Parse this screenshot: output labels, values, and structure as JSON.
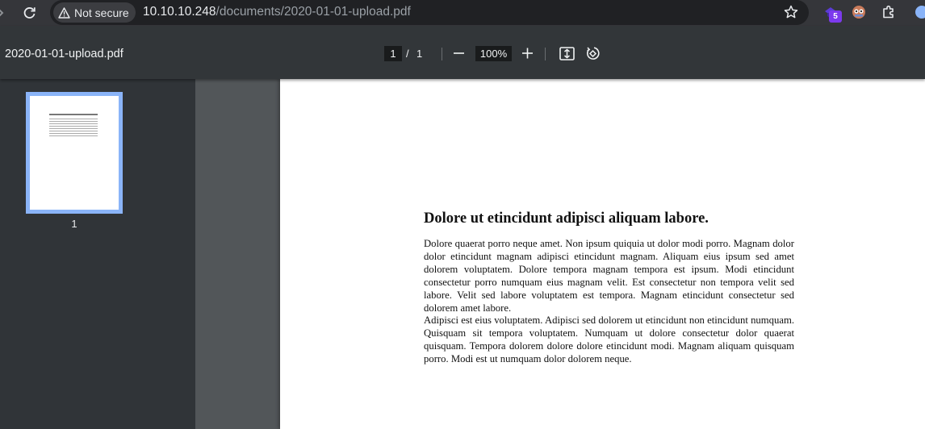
{
  "browser": {
    "security_label": "Not secure",
    "url_host": "10.10.10.248",
    "url_path": "/documents/2020-01-01-upload.pdf",
    "extension_badge": "5",
    "colors": {
      "toolbar": "#35363a",
      "omnibox": "#202124",
      "badge": "#7c3aed"
    }
  },
  "pdf_toolbar": {
    "title": "2020-01-01-upload.pdf",
    "current_page": "1",
    "page_separator": "/",
    "total_pages": "1",
    "zoom": "100%"
  },
  "sidebar": {
    "thumbnails": [
      {
        "label": "1"
      }
    ]
  },
  "document": {
    "heading": "Dolore ut etincidunt adipisci aliquam labore.",
    "paragraphs": [
      "Dolore quaerat porro neque amet. Non ipsum quiquia ut dolor modi porro. Magnam dolor dolor etincidunt magnam adipisci etincidunt magnam. Aliquam eius ipsum sed amet dolorem voluptatem. Dolore tempora magnam tempora est ipsum. Modi etincidunt consectetur porro numquam eius magnam velit. Est consectetur non tempora velit sed labore. Velit sed labore voluptatem est tempora. Magnam etincidunt consectetur sed dolorem amet labore.",
      "Adipisci est eius voluptatem. Adipisci sed dolorem ut etincidunt non etincidunt numquam. Quisquam sit tempora voluptatem. Numquam ut dolore consectetur dolor quaerat quisquam. Tempora dolorem dolore dolore etincidunt modi. Magnam aliquam quisquam porro. Modi est ut numquam dolor dolorem neque."
    ]
  }
}
